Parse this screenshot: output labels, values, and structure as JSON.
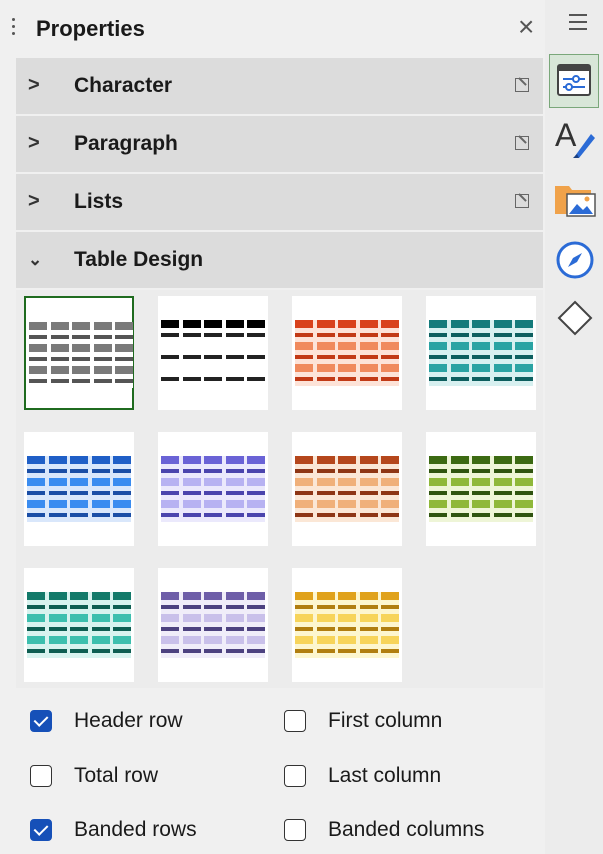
{
  "panel": {
    "title": "Properties",
    "close_glyph": "×"
  },
  "sections": [
    {
      "label": "Character",
      "expanded": false
    },
    {
      "label": "Paragraph",
      "expanded": false
    },
    {
      "label": "Lists",
      "expanded": false
    },
    {
      "label": "Table Design",
      "expanded": true
    }
  ],
  "table_styles": [
    {
      "head": "#7a7a7a",
      "band": "#7a7a7a",
      "line": "#555555",
      "bg": "#ffffff",
      "selected": true
    },
    {
      "head": "#000000",
      "band": "#ffffff",
      "line": "#222222",
      "bg": "#ffffff",
      "selected": false
    },
    {
      "head": "#d9421c",
      "band": "#f08a5d",
      "line": "#c23a16",
      "bg": "#fde3d8",
      "selected": false
    },
    {
      "head": "#147b7b",
      "band": "#2aa3a3",
      "line": "#0d5f5f",
      "bg": "#d7f0f0",
      "selected": false
    },
    {
      "head": "#1f5fc7",
      "band": "#3a8cf0",
      "line": "#1a4ea6",
      "bg": "#d9e7fb",
      "selected": false
    },
    {
      "head": "#6a63d6",
      "band": "#b7b2f2",
      "line": "#4b45ad",
      "bg": "#ebe9fc",
      "selected": false
    },
    {
      "head": "#b5471c",
      "band": "#f0b07a",
      "line": "#8e3615",
      "bg": "#fbe7d6",
      "selected": false
    },
    {
      "head": "#3c6a12",
      "band": "#8fb83a",
      "line": "#2f5410",
      "bg": "#eef5d7",
      "selected": false
    },
    {
      "head": "#137a6a",
      "band": "#3dbfae",
      "line": "#0e5e52",
      "bg": "#d8f3ef",
      "selected": false
    },
    {
      "head": "#6e5ea8",
      "band": "#c9c0ea",
      "line": "#4d4280",
      "bg": "#f0edf9",
      "selected": false
    },
    {
      "head": "#e0a21c",
      "band": "#f7d45a",
      "line": "#b17e10",
      "bg": "#fdf6cf",
      "selected": false
    }
  ],
  "options": [
    {
      "label": "Header row",
      "checked": true
    },
    {
      "label": "First column",
      "checked": false
    },
    {
      "label": "Total row",
      "checked": false
    },
    {
      "label": "Last column",
      "checked": false
    },
    {
      "label": "Banded rows",
      "checked": true
    },
    {
      "label": "Banded columns",
      "checked": false
    }
  ],
  "sidebar_tabs": [
    "menu-icon",
    "properties-icon",
    "styles-icon",
    "gallery-icon",
    "navigator-icon",
    "shapes-icon"
  ]
}
